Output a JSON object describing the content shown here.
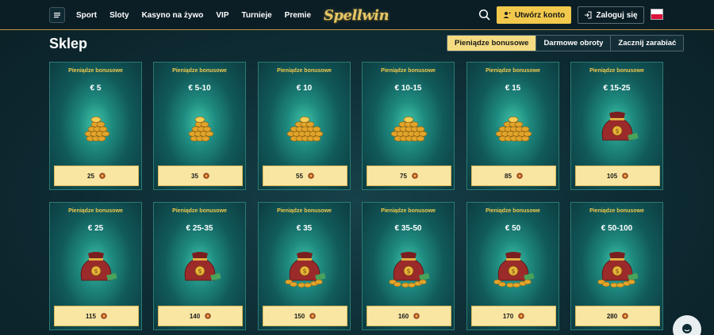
{
  "header": {
    "nav": [
      "Sport",
      "Sloty",
      "Kasyno na żywo",
      "VIP",
      "Turnieje",
      "Premie"
    ],
    "logo": "Spellwin",
    "register_label": "Utwórz konto",
    "login_label": "Zaloguj się"
  },
  "page": {
    "title": "Sklep",
    "tabs": [
      "Pieniądze bonusowe",
      "Darmowe obroty",
      "Zacznij zarabiać"
    ],
    "active_tab": "Pieniądze bonusowe"
  },
  "cards": [
    {
      "title": "Pieniądze bonusowe",
      "amount": "€ 5",
      "price": "25",
      "image": "coins-small"
    },
    {
      "title": "Pieniądze bonusowe",
      "amount": "€ 5-10",
      "price": "35",
      "image": "coins-small"
    },
    {
      "title": "Pieniądze bonusowe",
      "amount": "€ 10",
      "price": "55",
      "image": "coins-large"
    },
    {
      "title": "Pieniądze bonusowe",
      "amount": "€ 10-15",
      "price": "75",
      "image": "coins-large"
    },
    {
      "title": "Pieniądze bonusowe",
      "amount": "€ 15",
      "price": "85",
      "image": "coins-large"
    },
    {
      "title": "Pieniądze bonusowe",
      "amount": "€ 15-25",
      "price": "105",
      "image": "money-bag"
    },
    {
      "title": "Pieniądze bonusowe",
      "amount": "€ 25",
      "price": "115",
      "image": "money-bag"
    },
    {
      "title": "Pieniądze bonusowe",
      "amount": "€ 25-35",
      "price": "140",
      "image": "money-bag"
    },
    {
      "title": "Pieniądze bonusowe",
      "amount": "€ 35",
      "price": "150",
      "image": "money-bag-coins"
    },
    {
      "title": "Pieniądze bonusowe",
      "amount": "€ 35-50",
      "price": "160",
      "image": "money-bag-coins"
    },
    {
      "title": "Pieniądze bonusowe",
      "amount": "€ 50",
      "price": "170",
      "image": "money-bag-coins"
    },
    {
      "title": "Pieniądze bonusowe",
      "amount": "€ 50-100",
      "price": "280",
      "image": "money-bag-coins"
    }
  ],
  "colors": {
    "accent": "#f2c94c",
    "header_bg": "#0b1e26",
    "card_glow": "#3fc5a8",
    "price_bg": "#f9e6a3"
  }
}
